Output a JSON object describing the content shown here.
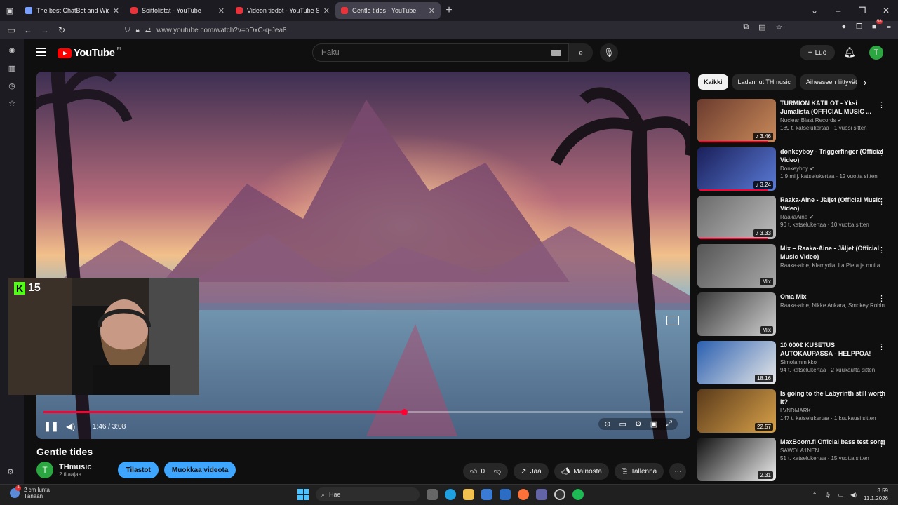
{
  "browser": {
    "tabs": [
      {
        "title": "The best ChatBot and Widgets",
        "active": false
      },
      {
        "title": "Soittolistat - YouTube",
        "active": false
      },
      {
        "title": "Videon tiedot - YouTube Studio",
        "active": false
      },
      {
        "title": "Gentle tides - YouTube",
        "active": true
      }
    ],
    "url": "www.youtube.com/watch?v=oDxC-q-Jea8",
    "badge_count": "58"
  },
  "youtube": {
    "logo_text": "YouTube",
    "logo_country": "FI",
    "search_placeholder": "Haku",
    "create_label": "Luo",
    "avatar_letter": "T"
  },
  "player": {
    "current_time": "1:46",
    "duration": "3:08",
    "time_display": "1:46 / 3:08",
    "progress_fraction": 0.564
  },
  "stream_overlay": {
    "badge_letter": "K",
    "viewer_count": "15"
  },
  "video": {
    "title": "Gentle tides",
    "channel_name": "THmusic",
    "channel_initial": "T",
    "subscribers": "2 tilaajaa",
    "stats_button": "Tilastot",
    "edit_button": "Muokkaa videota",
    "likes": "0",
    "share_label": "Jaa",
    "promote_label": "Mainosta",
    "save_label": "Tallenna"
  },
  "chips": [
    "Kaikki",
    "Ladannut THmusic",
    "Aiheeseen liittyvät"
  ],
  "recommendations": [
    {
      "title": "TURMION KÄTILÖT - Yksi Jumalista (OFFICIAL MUSIC ...",
      "channel": "Nuclear Blast Records ✔",
      "meta": "189 t. katselukertaa · 1 vuosi sitten",
      "badge": "♪ 3.46",
      "colors": [
        "#6b3b2e",
        "#c98a5a"
      ],
      "watched": 0.9
    },
    {
      "title": "donkeyboy - Triggerfinger (Official Video)",
      "channel": "Donkeyboy ✔",
      "meta": "1,9 milj. katselukertaa · 12 vuotta sitten",
      "badge": "♪ 3.24",
      "colors": [
        "#1a1f5a",
        "#5a7bd6"
      ],
      "watched": 0.9
    },
    {
      "title": "Raaka-Aine - Jäljet (Official Music Video)",
      "channel": "RaakaAine ✔",
      "meta": "90 t. katselukertaa · 10 vuotta sitten",
      "badge": "♪ 3.33",
      "colors": [
        "#6a6a6a",
        "#bcbcbc"
      ],
      "watched": 0.9
    },
    {
      "title": "Mix – Raaka-Aine - Jäljet (Official Music Video)",
      "channel": "Raaka-aine, Klamydia, La Pieta ja muita",
      "meta": "",
      "badge": "Mix",
      "colors": [
        "#555555",
        "#a9a9a9"
      ],
      "watched": 0
    },
    {
      "title": "Oma Mix",
      "channel": "Raaka-aine, Nikke Ankara, Smokey Robin...",
      "meta": "",
      "badge": "Mix",
      "colors": [
        "#3a3a3a",
        "#cfcfcf"
      ],
      "watched": 0
    },
    {
      "title": "10 000€ KUSETUS AUTOKAUPASSA - HELPPOA!",
      "channel": "Simolammikko",
      "meta": "94 t. katselukertaa · 2 kuukautta sitten",
      "badge": "18.16",
      "colors": [
        "#2a5fb0",
        "#e8e8e8"
      ],
      "watched": 0
    },
    {
      "title": "Is going to the Labyrinth still worth it?",
      "channel": "LVNDMARK",
      "meta": "147 t. katselukertaa · 1 kuukausi sitten",
      "badge": "22.57",
      "colors": [
        "#5a3a1a",
        "#d9a24a"
      ],
      "watched": 0
    },
    {
      "title": "MaxBoom.fi Official bass test song",
      "channel": "SAWOLA1NEN",
      "meta": "51 t. katselukertaa · 15 vuotta sitten",
      "badge": "2.31",
      "colors": [
        "#111111",
        "#eeeeee"
      ],
      "watched": 0
    }
  ],
  "taskbar": {
    "weather_temp": "2 cm lunta",
    "weather_sub": "Tänään",
    "weather_alert": "1",
    "search_label": "Hae",
    "time": "3.59",
    "date": "11.1.2026"
  }
}
